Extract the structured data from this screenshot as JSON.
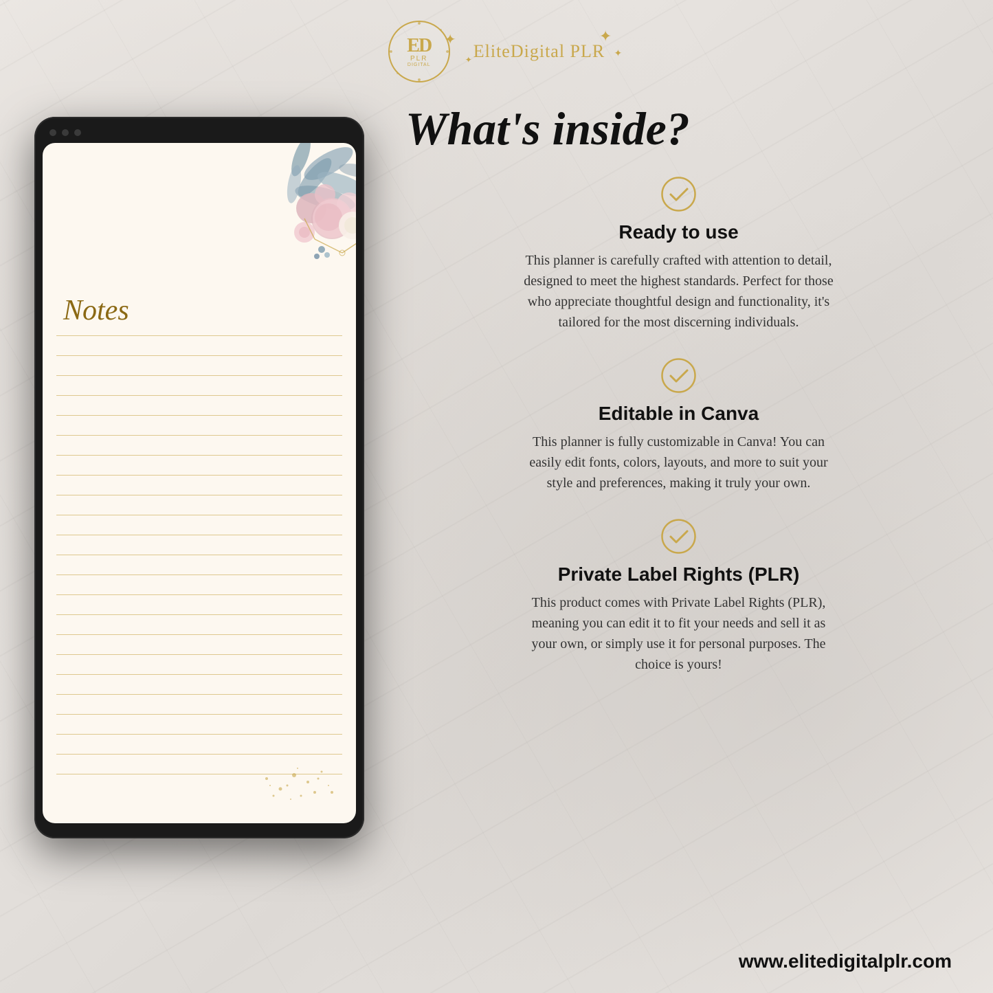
{
  "brand": {
    "logo_letters": "ED",
    "logo_plr": "PLR",
    "logo_digital": "DIGITAL",
    "logo_name": "EliteDigital PLR"
  },
  "page": {
    "main_heading": "What's inside?",
    "features": [
      {
        "id": "ready",
        "title": "Ready to use",
        "description": "This planner is carefully crafted with attention to detail, designed to meet the highest standards. Perfect for those who appreciate thoughtful design and functionality, it's tailored for the most discerning individuals."
      },
      {
        "id": "canva",
        "title": "Editable in Canva",
        "description": "This planner is fully customizable in Canva! You can easily edit fonts, colors, layouts, and more to suit your style and preferences, making it truly your own."
      },
      {
        "id": "plr",
        "title": "Private Label Rights (PLR)",
        "description": "This product comes with Private Label Rights (PLR), meaning you can edit it to fit your needs and sell it as your own, or simply use it for personal purposes. The choice is yours!"
      }
    ],
    "notes_label": "Notes",
    "website": "www.elitedigitalplr.com"
  }
}
